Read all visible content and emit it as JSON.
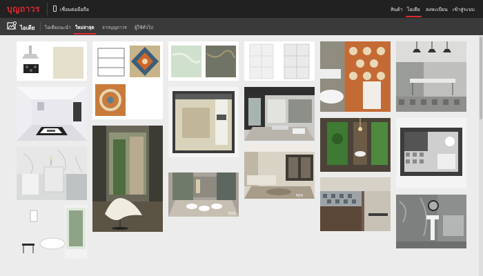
{
  "header": {
    "logo": "บุญถาวร",
    "connect_label": "เชื่อมต่อมือถือ",
    "nav": [
      {
        "label": "สินค้า",
        "active": false
      },
      {
        "label": "ไอเดีย",
        "active": true
      },
      {
        "label": "ลงทะเบียน",
        "active": false
      },
      {
        "label": "เข้าสู่ระบบ",
        "active": false
      }
    ]
  },
  "subheader": {
    "title": "ไอเดีย",
    "tabs": [
      {
        "label": "ไอเดียแนะนำ",
        "active": false
      },
      {
        "label": "ใหม่ล่าสุด",
        "active": true
      },
      {
        "label": "จากบุญถาวร",
        "active": false
      },
      {
        "label": "ผู้ใช้ทั่วไป",
        "active": false
      }
    ]
  },
  "gallery": {
    "columns": [
      [
        "Kitchen hood and gas hob",
        "Living room with black and white rug",
        "White marble bathroom",
        "White bathroom with freestanding tub"
      ],
      [
        "Wire shelving rack with patterned tiles",
        "Courtyard patio with lounge chair"
      ],
      [
        "Green and grey marble tiles",
        "Top view of room layout",
        "Living room with ottomans"
      ],
      [
        "White marble wall tiles",
        "Modern dining and living room",
        "Living room with long sofa"
      ],
      [
        "Bathroom with patterned tiles",
        "Bathroom with green tiles",
        "Kitchen with patterned backsplash"
      ],
      [
        "Dining area with pendant lamps",
        "Top view bathroom layout",
        "Bathroom with round mirror"
      ]
    ],
    "watermark": "NVS"
  },
  "colors": {
    "brand_red": "#e0282e",
    "topbar_bg": "#212121",
    "subbar_bg": "#3a3a3a",
    "page_bg": "#ececec"
  }
}
